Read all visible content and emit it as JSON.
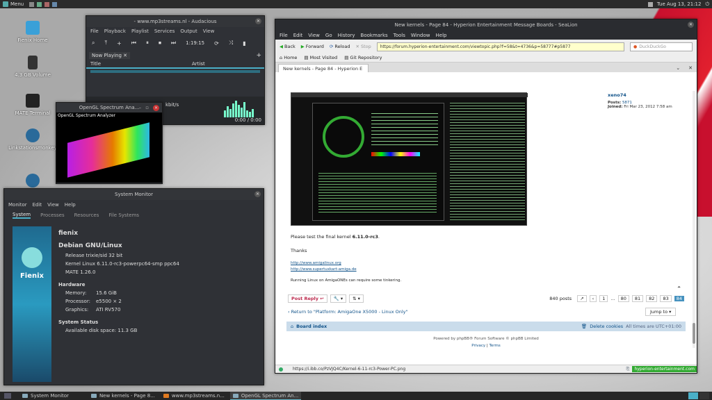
{
  "topbar": {
    "menu_label": "Menu",
    "clock": "Tue Aug 13, 21:12"
  },
  "desktop_icons": [
    {
      "label": "Fienix Home"
    },
    {
      "label": "4.3 GB Volume"
    },
    {
      "label": "MATE Terminal"
    },
    {
      "label": "Linkstationsmonkey"
    }
  ],
  "audacious": {
    "title": "- www.mp3streams.nl - Audacious",
    "menu": [
      "File",
      "Playback",
      "Playlist",
      "Services",
      "Output",
      "View"
    ],
    "time": "1:19:15",
    "tab": "Now Playing",
    "columns": [
      "Title",
      "Artist"
    ],
    "bitrate": "kbit/s",
    "position": "0:00 / 0:00"
  },
  "spectrum": {
    "title": "OpenGL Spectrum Ana...",
    "label": "OpenGL Spectrum Analyzer"
  },
  "sysmon": {
    "title": "System Monitor",
    "menu": [
      "Monitor",
      "Edit",
      "View",
      "Help"
    ],
    "tabs": [
      "System",
      "Processes",
      "Resources",
      "File Systems"
    ],
    "hostname": "fienix",
    "distro": "Debian GNU/Linux",
    "release": "Release trixie/sid 32 bit",
    "kernel": "Kernel Linux 6.11.0-rc3-powerpc64-smp ppc64",
    "mate": "MATE 1.26.0",
    "logo_text": "Fienix",
    "hardware_heading": "Hardware",
    "memory_label": "Memory:",
    "memory_value": "15.6 GiB",
    "processor_label": "Processor:",
    "processor_value": "e5500 × 2",
    "graphics_label": "Graphics:",
    "graphics_value": "ATI RV570",
    "status_heading": "System Status",
    "disk_label": "Available disk space:",
    "disk_value": "11.3 GB"
  },
  "browser": {
    "title": "New kernels - Page 84 - Hyperion Entertainment Message Boards - SeaLion",
    "menu": [
      "File",
      "Edit",
      "View",
      "Go",
      "History",
      "Bookmarks",
      "Tools",
      "Window",
      "Help"
    ],
    "back": "Back",
    "forward": "Forward",
    "reload": "Reload",
    "stop": "Stop",
    "url": "https://forum.hyperion-entertainment.com/viewtopic.php?f=58&t=4736&p=58777#p5877",
    "search_placeholder": "DuckDuckGo",
    "bookmarks": [
      "Home",
      "Most Visited",
      "Git Repository"
    ],
    "tab": "New kernels - Page 84 - Hyperion E",
    "post_author": "xeno74",
    "posts_label": "Posts:",
    "posts_value": "5871",
    "joined_label": "Joined:",
    "joined_value": "Fri Mar 23, 2012 7:58 am",
    "test_text": "Please test the final kernel ",
    "kernel_bold": "6.11.0-rc3",
    "thanks": "Thanks",
    "link1": "http://www.amigalinux.org",
    "link2": "http://www.supertuxkart-amiga.de",
    "footer_note": "Running Linux on AmigaONEs can require some tinkering.",
    "post_reply": "Post Reply",
    "posts_count": "840 posts",
    "pages": [
      "1",
      "...",
      "80",
      "81",
      "82",
      "83",
      "84"
    ],
    "return_link": "Return to \"Platform: AmigaOne X5000 - Linux Only\"",
    "jump_to": "Jump to",
    "board_index": "Board index",
    "delete_cookies": "Delete cookies",
    "timezone": "All times are UTC+01:00",
    "powered": "Powered by phpBB® Forum Software © phpBB Limited",
    "privacy": "Privacy",
    "terms": "Terms",
    "status_url": "https://i.ibb.co/PzVJQ4C/Kernel-6-11-rc3-Power-PC.png",
    "status_site": "hyperion-entertainment.com"
  },
  "taskbar": [
    {
      "label": "System Monitor"
    },
    {
      "label": "New kernels - Page 8..."
    },
    {
      "label": "www.mp3streams.n..."
    },
    {
      "label": "OpenGL Spectrum An..."
    }
  ],
  "colors": {
    "accent": "#4ab0c8",
    "reply": "#bc2a4d",
    "link": "#105289"
  }
}
